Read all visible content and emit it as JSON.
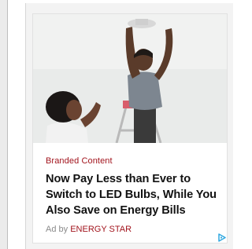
{
  "ad": {
    "sponsor_label": "Branded Content",
    "headline": "Now Pay Less than Ever to Switch to LED Bulbs, While You Also Save on Energy Bills",
    "advertiser_prefix": "Ad by",
    "advertiser_name": "ENERGY STAR",
    "image_description_icon": "ad-photo-icon",
    "adchoices_icon": "adchoices-icon"
  },
  "colors": {
    "accent_red": "#a2141d",
    "headline_text": "#121212",
    "muted_text": "#8a8a8a",
    "adchoices_blue": "#31a8e0"
  }
}
